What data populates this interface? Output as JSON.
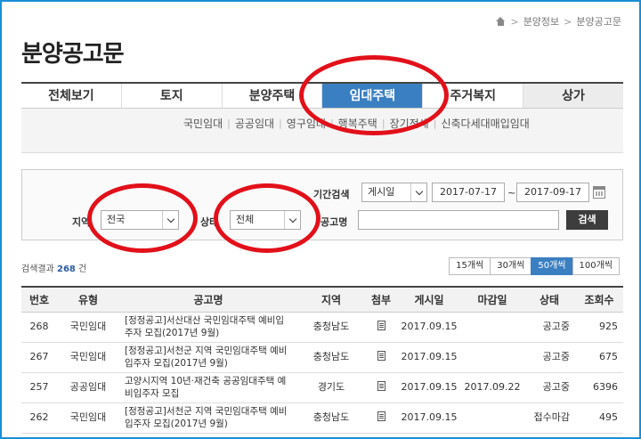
{
  "breadcrumb": {
    "items": [
      "분양정보",
      "분양공고문"
    ]
  },
  "page_title": "분양공고문",
  "tabs": [
    {
      "label": "전체보기"
    },
    {
      "label": "토지"
    },
    {
      "label": "분양주택"
    },
    {
      "label": "임대주택",
      "active": true
    },
    {
      "label": "주거복지"
    },
    {
      "label": "상가"
    }
  ],
  "subtabs": [
    "국민임대",
    "공공임대",
    "영구임대",
    "행복주택",
    "장기전세",
    "신축다세대매입임대"
  ],
  "search": {
    "period_label": "기간검색",
    "period_type": "게시일",
    "date_from": "2017-07-17",
    "date_tilde": "~",
    "date_to": "2017-09-17",
    "region_label": "지역",
    "region_value": "전국",
    "status_label": "상태",
    "status_value": "전체",
    "notice_label": "공고명",
    "notice_value": "",
    "search_button": "검색"
  },
  "results": {
    "label": "검색결과",
    "count": "268",
    "unit": "건"
  },
  "per_page": [
    {
      "label": "15개씩"
    },
    {
      "label": "30개씩"
    },
    {
      "label": "50개씩",
      "active": true
    },
    {
      "label": "100개씩"
    }
  ],
  "table": {
    "headers": [
      "번호",
      "유형",
      "공고명",
      "지역",
      "첨부",
      "게시일",
      "마감일",
      "상태",
      "조회수"
    ],
    "rows": [
      {
        "no": "268",
        "type": "국민임대",
        "title": "[정정공고]서산대산 국민임대주택 예비입주자 모집(2017년 9월)",
        "region": "충청남도",
        "posted": "2017.09.15",
        "deadline": "",
        "status": "공고중",
        "views": "925"
      },
      {
        "no": "267",
        "type": "국민임대",
        "title": "[정정공고]서천군 지역 국민임대주택 예비입주자 모집(2017년 9월)",
        "region": "충청남도",
        "posted": "2017.09.15",
        "deadline": "",
        "status": "공고중",
        "views": "675"
      },
      {
        "no": "257",
        "type": "공공임대",
        "title": "고양시지역 10년·재건축 공공임대주택 예비입주자 모집",
        "region": "경기도",
        "posted": "2017.09.15",
        "deadline": "2017.09.22",
        "status": "공고중",
        "views": "6396"
      },
      {
        "no": "262",
        "type": "국민임대",
        "title": "[정정공고]서천군 지역 국민임대주택 예비입주자 모집(2017년 9월)",
        "region": "충청남도",
        "posted": "2017.09.15",
        "deadline": "",
        "status": "접수마감",
        "views": "495"
      }
    ]
  },
  "colors": {
    "accent": "#3a7fc1",
    "annotation": "#e2101a",
    "frame": "#1a8fd6"
  }
}
